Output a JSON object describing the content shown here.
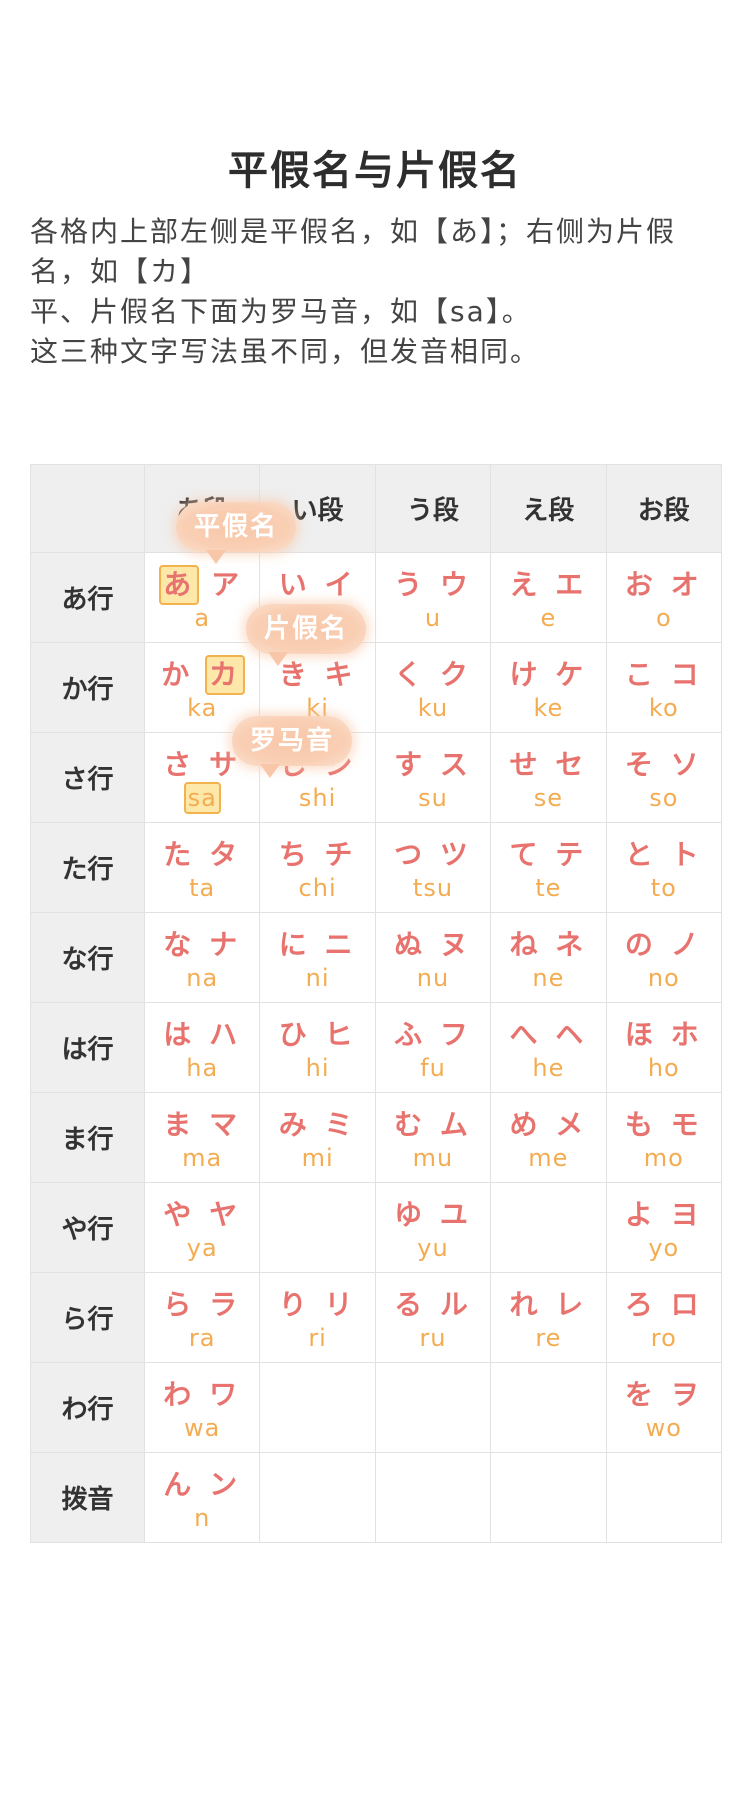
{
  "title": "平假名与片假名",
  "description": [
    "各格内上部左侧是平假名，如【あ】；右侧为片假名，如【カ】",
    "平、片假名下面为罗马音，如【sa】。",
    "这三种文字写法虽不同，但发音相同。"
  ],
  "columns": [
    "",
    "あ段",
    "い段",
    "う段",
    "え段",
    "お段"
  ],
  "rows": [
    {
      "label": "あ行",
      "cells": [
        {
          "h": "あ",
          "k": "ア",
          "r": "a"
        },
        {
          "h": "い",
          "k": "イ",
          "r": "i"
        },
        {
          "h": "う",
          "k": "ウ",
          "r": "u"
        },
        {
          "h": "え",
          "k": "エ",
          "r": "e"
        },
        {
          "h": "お",
          "k": "オ",
          "r": "o"
        }
      ]
    },
    {
      "label": "か行",
      "cells": [
        {
          "h": "か",
          "k": "カ",
          "r": "ka"
        },
        {
          "h": "き",
          "k": "キ",
          "r": "ki"
        },
        {
          "h": "く",
          "k": "ク",
          "r": "ku"
        },
        {
          "h": "け",
          "k": "ケ",
          "r": "ke"
        },
        {
          "h": "こ",
          "k": "コ",
          "r": "ko"
        }
      ]
    },
    {
      "label": "さ行",
      "cells": [
        {
          "h": "さ",
          "k": "サ",
          "r": "sa"
        },
        {
          "h": "し",
          "k": "シ",
          "r": "shi"
        },
        {
          "h": "す",
          "k": "ス",
          "r": "su"
        },
        {
          "h": "せ",
          "k": "セ",
          "r": "se"
        },
        {
          "h": "そ",
          "k": "ソ",
          "r": "so"
        }
      ]
    },
    {
      "label": "た行",
      "cells": [
        {
          "h": "た",
          "k": "タ",
          "r": "ta"
        },
        {
          "h": "ち",
          "k": "チ",
          "r": "chi"
        },
        {
          "h": "つ",
          "k": "ツ",
          "r": "tsu"
        },
        {
          "h": "て",
          "k": "テ",
          "r": "te"
        },
        {
          "h": "と",
          "k": "ト",
          "r": "to"
        }
      ]
    },
    {
      "label": "な行",
      "cells": [
        {
          "h": "な",
          "k": "ナ",
          "r": "na"
        },
        {
          "h": "に",
          "k": "ニ",
          "r": "ni"
        },
        {
          "h": "ぬ",
          "k": "ヌ",
          "r": "nu"
        },
        {
          "h": "ね",
          "k": "ネ",
          "r": "ne"
        },
        {
          "h": "の",
          "k": "ノ",
          "r": "no"
        }
      ]
    },
    {
      "label": "は行",
      "cells": [
        {
          "h": "は",
          "k": "ハ",
          "r": "ha"
        },
        {
          "h": "ひ",
          "k": "ヒ",
          "r": "hi"
        },
        {
          "h": "ふ",
          "k": "フ",
          "r": "fu"
        },
        {
          "h": "へ",
          "k": "ヘ",
          "r": "he"
        },
        {
          "h": "ほ",
          "k": "ホ",
          "r": "ho"
        }
      ]
    },
    {
      "label": "ま行",
      "cells": [
        {
          "h": "ま",
          "k": "マ",
          "r": "ma"
        },
        {
          "h": "み",
          "k": "ミ",
          "r": "mi"
        },
        {
          "h": "む",
          "k": "ム",
          "r": "mu"
        },
        {
          "h": "め",
          "k": "メ",
          "r": "me"
        },
        {
          "h": "も",
          "k": "モ",
          "r": "mo"
        }
      ]
    },
    {
      "label": "や行",
      "cells": [
        {
          "h": "や",
          "k": "ヤ",
          "r": "ya"
        },
        null,
        {
          "h": "ゆ",
          "k": "ユ",
          "r": "yu"
        },
        null,
        {
          "h": "よ",
          "k": "ヨ",
          "r": "yo"
        }
      ]
    },
    {
      "label": "ら行",
      "cells": [
        {
          "h": "ら",
          "k": "ラ",
          "r": "ra"
        },
        {
          "h": "り",
          "k": "リ",
          "r": "ri"
        },
        {
          "h": "る",
          "k": "ル",
          "r": "ru"
        },
        {
          "h": "れ",
          "k": "レ",
          "r": "re"
        },
        {
          "h": "ろ",
          "k": "ロ",
          "r": "ro"
        }
      ]
    },
    {
      "label": "わ行",
      "cells": [
        {
          "h": "わ",
          "k": "ワ",
          "r": "wa"
        },
        null,
        null,
        null,
        {
          "h": "を",
          "k": "ヲ",
          "r": "wo"
        }
      ]
    },
    {
      "label": "拨音",
      "cells": [
        {
          "h": "ん",
          "k": "ン",
          "r": "n"
        },
        null,
        null,
        null,
        null
      ]
    }
  ],
  "callouts": {
    "hiragana": "平假名",
    "katakana": "片假名",
    "romaji": "罗马音"
  },
  "colors": {
    "kana": "#e8736e",
    "romaji": "#f3ac51",
    "header_bg": "#efefef",
    "highlight": "#fde7a9"
  }
}
